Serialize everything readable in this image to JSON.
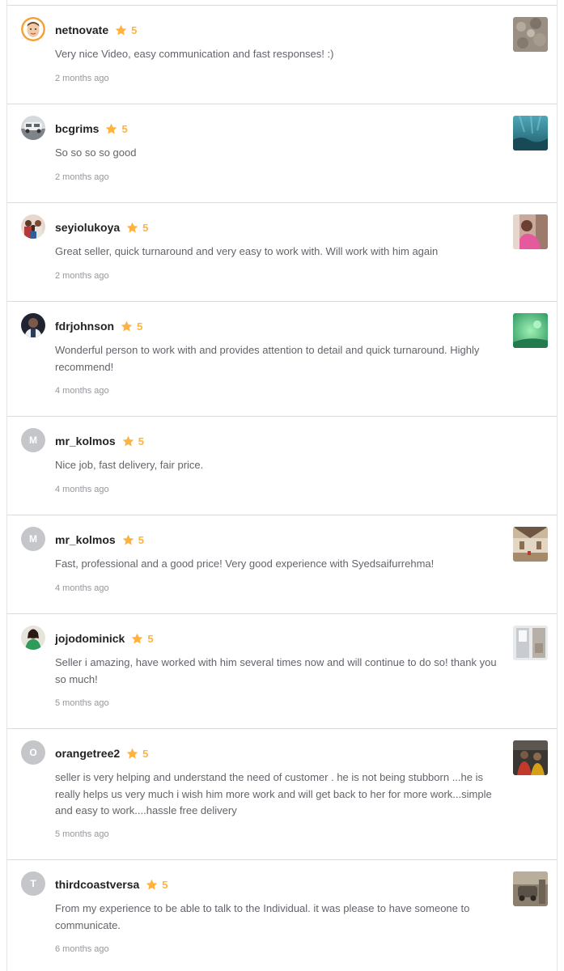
{
  "reviews": [
    {
      "username": "netnovate",
      "rating": "5",
      "text": "Very nice Video, easy communication and fast responses! :)",
      "time": "2 months ago",
      "avatar": {
        "type": "image",
        "icon": "cartoon-face-avatar"
      },
      "thumb": "rocky-terrain-thumbnail"
    },
    {
      "username": "bcgrims",
      "rating": "5",
      "text": "So so so so good",
      "time": "2 months ago",
      "avatar": {
        "type": "image",
        "icon": "vehicle-photo-avatar"
      },
      "thumb": "underwater-scene-thumbnail"
    },
    {
      "username": "seyiolukoya",
      "rating": "5",
      "text": "Great seller, quick turnaround and very easy to work with. Will work with him again",
      "time": "2 months ago",
      "avatar": {
        "type": "image",
        "icon": "group-photo-avatar"
      },
      "thumb": "person-pink-thumbnail"
    },
    {
      "username": "fdrjohnson",
      "rating": "5",
      "text": "Wonderful person to work with and provides attention to detail and quick turnaround. Highly recommend!",
      "time": "4 months ago",
      "avatar": {
        "type": "image",
        "icon": "portrait-dark-avatar"
      },
      "thumb": "green-scene-thumbnail"
    },
    {
      "username": "mr_kolmos",
      "rating": "5",
      "text": "Nice job, fast delivery, fair price.",
      "time": "4 months ago",
      "avatar": {
        "type": "letter",
        "letter": "M"
      },
      "thumb": ""
    },
    {
      "username": "mr_kolmos",
      "rating": "5",
      "text": "Fast, professional and a good price! Very good experience with Syedsaifurrehma!",
      "time": "4 months ago",
      "avatar": {
        "type": "letter",
        "letter": "M"
      },
      "thumb": "interior-room-thumbnail"
    },
    {
      "username": "jojodominick",
      "rating": "5",
      "text": "Seller i amazing, have worked with him several times now and will continue to do so! thank you so much!",
      "time": "5 months ago",
      "avatar": {
        "type": "image",
        "icon": "woman-green-avatar"
      },
      "thumb": "window-scene-thumbnail"
    },
    {
      "username": "orangetree2",
      "rating": "5",
      "text": "seller is very helping and understand the need of customer . he is not being stubborn ...he is really helps us very much i wish him more work and will get back to her for more work...simple and easy to work....hassle free delivery",
      "time": "5 months ago",
      "avatar": {
        "type": "letter",
        "letter": "O"
      },
      "thumb": "dark-people-thumbnail"
    },
    {
      "username": "thirdcoastversa",
      "rating": "5",
      "text": "From my experience to be able to talk to the Individual. it was please to have someone to communicate.",
      "time": "6 months ago",
      "avatar": {
        "type": "letter",
        "letter": "T"
      },
      "thumb": "outdoor-car-thumbnail"
    }
  ],
  "colors": {
    "star": "#ffb33e",
    "username": "#222325",
    "body_text": "#62646a",
    "time": "#95979d",
    "letter_avatar_bg": "#c5c6c9",
    "divider": "#dadbdd"
  }
}
